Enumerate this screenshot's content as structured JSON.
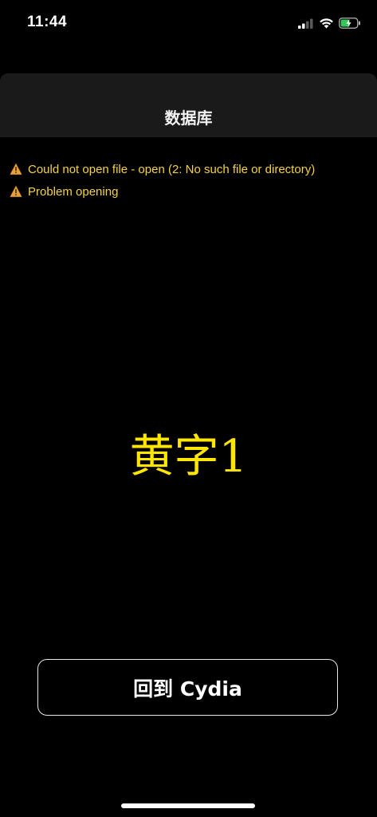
{
  "status_bar": {
    "time": "11:44",
    "signal_icon": "cellular-signal-icon",
    "wifi_icon": "wifi-icon",
    "battery_icon": "battery-charging-icon",
    "battery_color": "#34c759"
  },
  "nav": {
    "title": "数据库"
  },
  "messages": [
    {
      "icon": "warning-icon",
      "text": "Could not open file - open (2: No such file or directory)"
    },
    {
      "icon": "warning-icon",
      "text": "Problem opening"
    }
  ],
  "center_text": "黄字1",
  "return_button": {
    "label": "回到 Cydia"
  },
  "colors": {
    "background": "#000000",
    "header": "#1a1a1a",
    "message_text": "#f5d340",
    "center_text": "#ffe600"
  }
}
